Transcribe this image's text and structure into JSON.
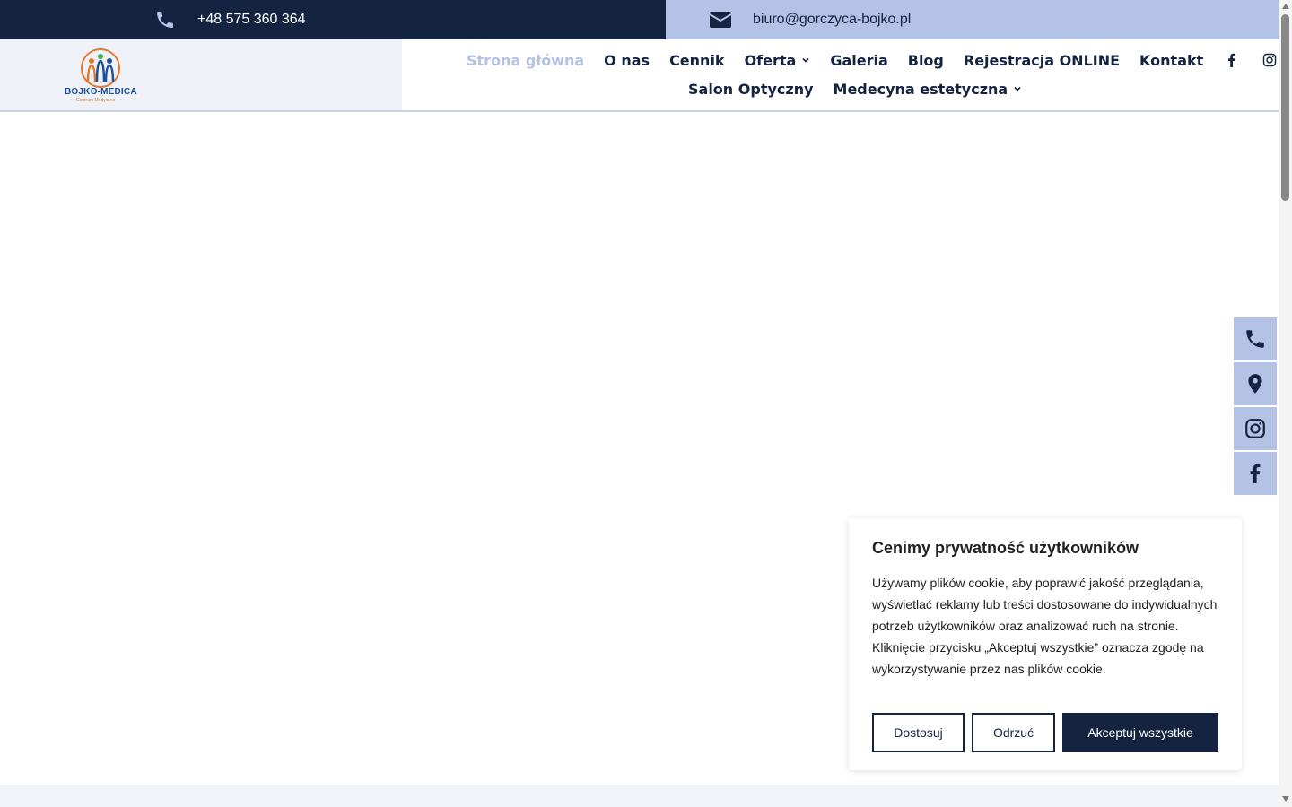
{
  "topbar": {
    "phone": "+48 575 360 364",
    "email": "biuro@gorczyca-bojko.pl",
    "phone_icon": "phone-icon",
    "email_icon": "envelope-icon"
  },
  "logo": {
    "name": "BOJKO-MEDICA",
    "subtitle": "Centrum Medyczne"
  },
  "nav": {
    "row1": [
      {
        "label": "Strona główna",
        "active": true
      },
      {
        "label": "O nas"
      },
      {
        "label": "Cennik"
      },
      {
        "label": "Oferta",
        "dropdown": true
      },
      {
        "label": "Galeria"
      },
      {
        "label": "Blog"
      },
      {
        "label": "Rejestracja ONLINE"
      },
      {
        "label": "Kontakt"
      }
    ],
    "row2": [
      {
        "label": "Salon Optyczny"
      },
      {
        "label": "Medecyna estetyczna",
        "dropdown": true
      }
    ],
    "social": [
      "facebook-icon",
      "instagram-icon"
    ]
  },
  "side_buttons": [
    "phone-icon",
    "location-pin-icon",
    "instagram-icon",
    "facebook-icon"
  ],
  "cookie": {
    "title": "Cenimy prywatność użytkowników",
    "text": "Używamy plików cookie, aby poprawić jakość przeglądania, wyświetlać reklamy lub treści dostosowane do indywidualnych potrzeb użytkowników oraz analizować ruch na stronie. Kliknięcie przycisku „Akceptuj wszystkie” oznacza zgodę na wykorzystywanie przez nas plików cookie.",
    "customize": "Dostosuj",
    "reject": "Odrzuć",
    "accept": "Akceptuj wszystkie"
  },
  "colors": {
    "navy": "#142340",
    "light_blue": "#b3c2e5",
    "pale": "#eef2f8"
  }
}
